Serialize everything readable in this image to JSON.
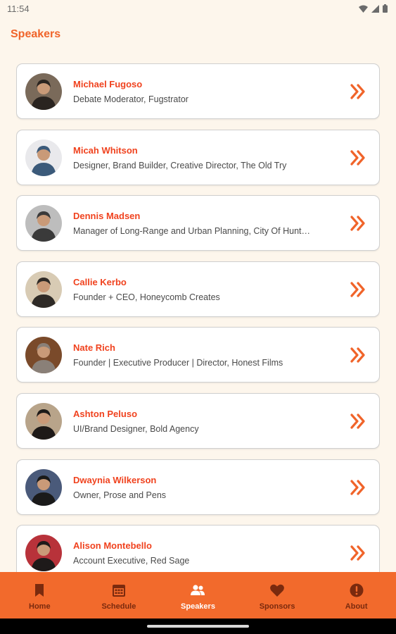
{
  "status_bar": {
    "time": "11:54"
  },
  "page": {
    "title": "Speakers"
  },
  "speakers": [
    {
      "name": "Michael Fugoso",
      "role": "Debate Moderator, Fugstrator",
      "avatar_bg": "#7a6a5a",
      "avatar_fg": "#2a2420"
    },
    {
      "name": "Micah Whitson",
      "role": "Designer, Brand Builder, Creative Director, The Old Try",
      "avatar_bg": "#e9e9ec",
      "avatar_fg": "#3b5a7a"
    },
    {
      "name": "Dennis Madsen",
      "role": "Manager of Long-Range and Urban Planning, City Of Hunt…",
      "avatar_bg": "#bdbdbd",
      "avatar_fg": "#3a3a3a"
    },
    {
      "name": "Callie Kerbo",
      "role": "Founder + CEO, Honeycomb Creates",
      "avatar_bg": "#d8cbb4",
      "avatar_fg": "#2e2a26"
    },
    {
      "name": "Nate Rich",
      "role": "Founder | Executive Producer | Director, Honest Films",
      "avatar_bg": "#7a4a2a",
      "avatar_fg": "#8a8078"
    },
    {
      "name": "Ashton Peluso",
      "role": "UI/Brand Designer, Bold Agency",
      "avatar_bg": "#b8a48a",
      "avatar_fg": "#1e1a18"
    },
    {
      "name": "Dwaynia Wilkerson",
      "role": "Owner, Prose and Pens",
      "avatar_bg": "#4a5a7a",
      "avatar_fg": "#1a1a1a"
    },
    {
      "name": "Alison Montebello",
      "role": "Account Executive, Red Sage",
      "avatar_bg": "#b8323a",
      "avatar_fg": "#1e1a1a"
    }
  ],
  "nav": [
    {
      "label": "Home",
      "icon": "bookmark-icon",
      "active": false
    },
    {
      "label": "Schedule",
      "icon": "calendar-icon",
      "active": false
    },
    {
      "label": "Speakers",
      "icon": "people-icon",
      "active": true
    },
    {
      "label": "Sponsors",
      "icon": "heart-icon",
      "active": false
    },
    {
      "label": "About",
      "icon": "info-icon",
      "active": false
    }
  ],
  "colors": {
    "accent": "#f0642a",
    "name_text": "#f0421e",
    "nav_bg": "#f26a2c",
    "nav_inactive": "#7a2a0e",
    "nav_active": "#ffffff",
    "page_bg": "#fdf6ec"
  }
}
